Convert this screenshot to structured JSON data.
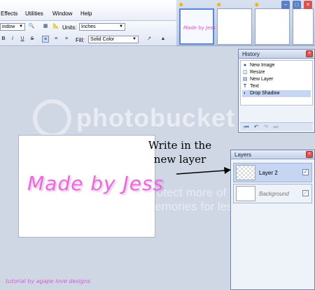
{
  "menu": {
    "items": [
      "Effects",
      "Utilities",
      "Window",
      "Help"
    ]
  },
  "toolbar": {
    "zoom_select_value": "indow",
    "units_label": "Units:",
    "units_value": "Inches",
    "bold_label": "B",
    "italic_label": "I",
    "underline_label": "U",
    "strike_label": "S",
    "fill_label": "Fill:",
    "fill_value": "Solid Color"
  },
  "thumbnails": {
    "selected_caption": "Made by Jess"
  },
  "history": {
    "title": "History",
    "items": [
      {
        "label": "New Image",
        "icon": "new-image-icon"
      },
      {
        "label": "Resize",
        "icon": "resize-icon"
      },
      {
        "label": "New Layer",
        "icon": "new-layer-icon"
      },
      {
        "label": "Text",
        "icon": "text-tool-icon"
      },
      {
        "label": "Drop Shadow",
        "icon": "drop-shadow-icon"
      }
    ],
    "selected_index": 4
  },
  "layers": {
    "title": "Layers",
    "rows": [
      {
        "name": "Layer 2",
        "visible": true,
        "selected": true
      },
      {
        "name": "Background",
        "visible": true,
        "selected": false
      }
    ]
  },
  "canvas": {
    "text": "Made by Jess",
    "text_color": "#e96ad8"
  },
  "annotation": {
    "line1": "Write in the",
    "line2": "new layer"
  },
  "watermark": {
    "brand": "photobucket",
    "tagline": "Protect more of your memories for less!"
  },
  "footer": {
    "credit": "tutorial by agape love designs"
  },
  "colors": {
    "workspace": "#cfd6e4",
    "panel_accent": "#6f86b3",
    "selection": "#c6d6f2",
    "close_button": "#d9534f"
  }
}
